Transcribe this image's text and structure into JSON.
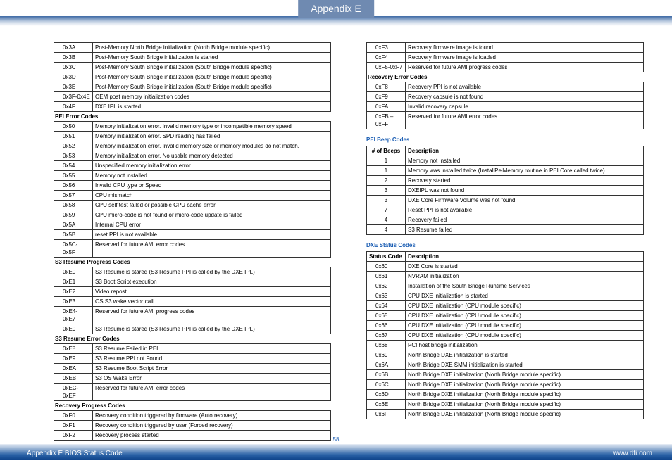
{
  "header": {
    "tab": "Appendix E"
  },
  "page_number": "58",
  "footer": {
    "left": "Appendix E BIOS Status Code",
    "right": "www.dfi.com"
  },
  "left_rows": [
    {
      "type": "row",
      "code": "0x3A",
      "desc": "Post-Memory North Bridge initialization (North Bridge module specific)"
    },
    {
      "type": "row",
      "code": "0x3B",
      "desc": "Post-Memory South Bridge initialization is started"
    },
    {
      "type": "row",
      "code": "0x3C",
      "desc": "Post-Memory South Bridge initialization (South Bridge module specific)"
    },
    {
      "type": "row",
      "code": "0x3D",
      "desc": "Post-Memory South Bridge initialization (South Bridge module specific)"
    },
    {
      "type": "row",
      "code": "0x3E",
      "desc": "Post-Memory South Bridge initialization (South Bridge module specific)"
    },
    {
      "type": "row",
      "code": "0x3F-0x4E",
      "desc": "OEM post memory initialization codes"
    },
    {
      "type": "row",
      "code": "0x4F",
      "desc": "DXE IPL is started"
    },
    {
      "type": "sub",
      "label": "PEI Error Codes"
    },
    {
      "type": "row",
      "code": "0x50",
      "desc": "Memory initialization error. Invalid memory type or incompatible memory speed"
    },
    {
      "type": "row",
      "code": "0x51",
      "desc": "Memory initialization error. SPD reading has failed"
    },
    {
      "type": "row",
      "code": "0x52",
      "desc": "Memory initialization error. Invalid memory size or memory modules do not match."
    },
    {
      "type": "row",
      "code": "0x53",
      "desc": "Memory initialization error. No usable memory detected"
    },
    {
      "type": "row",
      "code": "0x54",
      "desc": "Unspecified memory initialization error."
    },
    {
      "type": "row",
      "code": "0x55",
      "desc": "Memory not installed"
    },
    {
      "type": "row",
      "code": "0x56",
      "desc": "Invalid CPU type or Speed"
    },
    {
      "type": "row",
      "code": "0x57",
      "desc": "CPU mismatch"
    },
    {
      "type": "row",
      "code": "0x58",
      "desc": "CPU self test failed or possible CPU cache error"
    },
    {
      "type": "row",
      "code": "0x59",
      "desc": "CPU micro-code is not found or micro-code update is failed"
    },
    {
      "type": "row",
      "code": "0x5A",
      "desc": "Internal CPU error"
    },
    {
      "type": "row",
      "code": "0x5B",
      "desc": "reset PPI is  not available"
    },
    {
      "type": "row",
      "code": "0x5C-0x5F",
      "desc": "Reserved for future AMI error codes"
    },
    {
      "type": "sub",
      "label": "S3 Resume Progress Codes"
    },
    {
      "type": "row",
      "code": "0xE0",
      "desc": "S3 Resume is stared (S3 Resume PPI is called by the DXE IPL)"
    },
    {
      "type": "row",
      "code": "0xE1",
      "desc": "S3 Boot Script execution"
    },
    {
      "type": "row",
      "code": "0xE2",
      "desc": "Video repost"
    },
    {
      "type": "row",
      "code": "0xE3",
      "desc": "OS S3 wake vector call"
    },
    {
      "type": "row",
      "code": "0xE4-0xE7",
      "desc": "Reserved for future AMI progress codes"
    },
    {
      "type": "row",
      "code": "0xE0",
      "desc": "S3 Resume is stared (S3 Resume PPI is called by the DXE IPL)"
    },
    {
      "type": "sub",
      "label": "S3 Resume Error Codes"
    },
    {
      "type": "row",
      "code": "0xE8",
      "desc": "S3 Resume Failed in PEI"
    },
    {
      "type": "row",
      "code": "0xE9",
      "desc": "S3 Resume PPI not Found"
    },
    {
      "type": "row",
      "code": "0xEA",
      "desc": "S3 Resume Boot Script Error"
    },
    {
      "type": "row",
      "code": "0xEB",
      "desc": "S3 OS Wake Error"
    },
    {
      "type": "row",
      "code": "0xEC-0xEF",
      "desc": "Reserved for future AMI error codes"
    },
    {
      "type": "sub",
      "label": "Recovery Progress Codes"
    },
    {
      "type": "row",
      "code": "0xF0",
      "desc": "Recovery condition triggered by firmware (Auto recovery)"
    },
    {
      "type": "row",
      "code": "0xF1",
      "desc": "Recovery condition triggered by user (Forced recovery)"
    },
    {
      "type": "row",
      "code": "0xF2",
      "desc": "Recovery process started"
    }
  ],
  "right_top_rows": [
    {
      "type": "row",
      "code": "0xF3",
      "desc": "Recovery firmware image is found"
    },
    {
      "type": "row",
      "code": "0xF4",
      "desc": "Recovery firmware image is loaded"
    },
    {
      "type": "row",
      "code": "0xF5-0xF7",
      "desc": "Reserved for future AMI progress codes"
    },
    {
      "type": "sub",
      "label": "Recovery Error Codes"
    },
    {
      "type": "row",
      "code": "0xF8",
      "desc": "Recovery PPI is not available"
    },
    {
      "type": "row",
      "code": "0xF9",
      "desc": "Recovery capsule is not found"
    },
    {
      "type": "row",
      "code": "0xFA",
      "desc": "Invalid recovery capsule"
    },
    {
      "type": "row",
      "code": "0xFB – 0xFF",
      "desc": "Reserved for future AMI error codes"
    }
  ],
  "beep": {
    "title": "PEI Beep Codes",
    "h1": "# of Beeps",
    "h2": "Description",
    "rows": [
      {
        "n": "1",
        "d": "Memory not Installed"
      },
      {
        "n": "1",
        "d": "Memory was installed twice (InstallPeiMemory routine in PEI Core called twice)"
      },
      {
        "n": "2",
        "d": "Recovery started"
      },
      {
        "n": "3",
        "d": "DXEIPL was not found"
      },
      {
        "n": "3",
        "d": "DXE Core Firmware Volume was not found"
      },
      {
        "n": "7",
        "d": "Reset PPI is not available"
      },
      {
        "n": "4",
        "d": "Recovery failed"
      },
      {
        "n": "4",
        "d": "S3 Resume failed"
      }
    ]
  },
  "dxe": {
    "title": "DXE Status Codes",
    "h1": "Status Code",
    "h2": "Description",
    "rows": [
      {
        "c": "0x60",
        "d": "DXE Core is started"
      },
      {
        "c": "0x61",
        "d": "NVRAM initialization"
      },
      {
        "c": "0x62",
        "d": "Installation of the South Bridge Runtime Services"
      },
      {
        "c": "0x63",
        "d": "CPU DXE initialization is started"
      },
      {
        "c": "0x64",
        "d": "CPU DXE initialization (CPU module specific)"
      },
      {
        "c": "0x65",
        "d": "CPU DXE initialization (CPU module specific)"
      },
      {
        "c": "0x66",
        "d": "CPU DXE initialization (CPU module specific)"
      },
      {
        "c": "0x67",
        "d": "CPU DXE initialization (CPU module specific)"
      },
      {
        "c": "0x68",
        "d": "PCI host bridge initialization"
      },
      {
        "c": "0x69",
        "d": "North Bridge DXE initialization is started"
      },
      {
        "c": "0x6A",
        "d": "North Bridge DXE SMM initialization is started"
      },
      {
        "c": "0x6B",
        "d": "North Bridge  DXE initialization (North Bridge module specific)"
      },
      {
        "c": "0x6C",
        "d": "North Bridge  DXE initialization (North Bridge module specific)"
      },
      {
        "c": "0x6D",
        "d": "North Bridge  DXE initialization (North Bridge module specific)"
      },
      {
        "c": "0x6E",
        "d": "North Bridge  DXE initialization (North Bridge module specific)"
      },
      {
        "c": "0x6F",
        "d": "North Bridge  DXE initialization (North Bridge module specific)"
      }
    ]
  }
}
